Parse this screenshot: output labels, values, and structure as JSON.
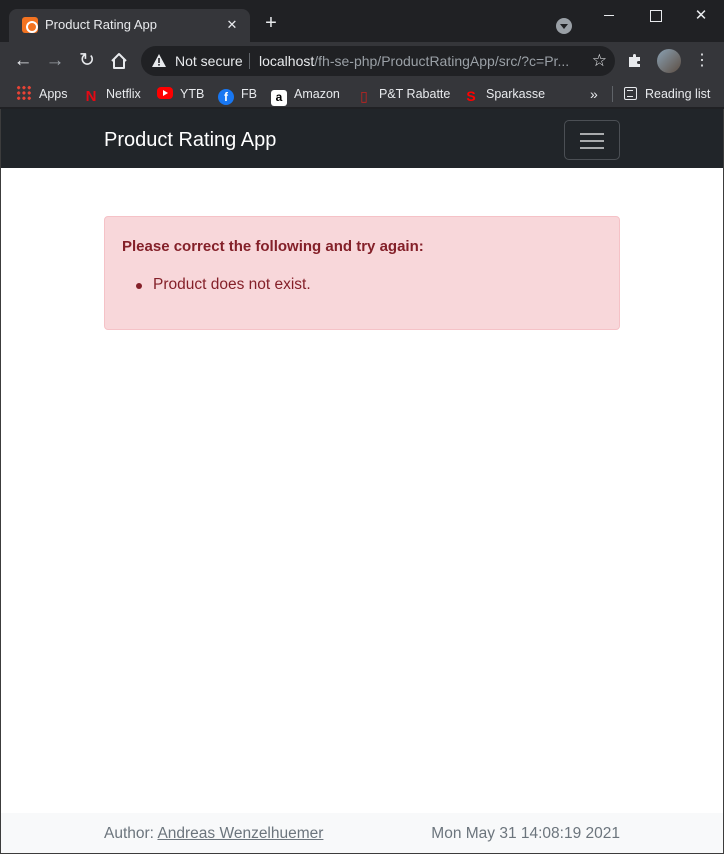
{
  "browser": {
    "tab_title": "Product Rating App",
    "tab_close_icon": "close-icon",
    "new_tab_icon": "plus-icon",
    "window_close_glyph": "✕",
    "security_label": "Not secure",
    "url_host": "localhost",
    "url_path": "/fh-se-php/ProductRatingApp/src/?c=Pr...",
    "bookmarks": [
      {
        "label": "Apps",
        "icon": "apps-grid-icon"
      },
      {
        "label": "Netflix",
        "icon": "netflix-icon"
      },
      {
        "label": "YTB",
        "icon": "youtube-icon"
      },
      {
        "label": "FB",
        "icon": "facebook-icon"
      },
      {
        "label": "Amazon",
        "icon": "amazon-icon"
      },
      {
        "label": "P&T Rabatte",
        "icon": "pt-rabatte-icon"
      },
      {
        "label": "Sparkasse",
        "icon": "sparkasse-icon"
      }
    ],
    "bookmarks_more": "»",
    "reading_list_label": "Reading list"
  },
  "app": {
    "brand": "Product Rating App",
    "alert": {
      "heading": "Please correct the following and try again:",
      "errors": [
        "Product does not exist."
      ]
    },
    "footer": {
      "author_prefix": "Author: ",
      "author_name": "Andreas Wenzelhuemer",
      "timestamp": "Mon May 31 14:08:19 2021"
    }
  },
  "colors": {
    "navbar": "#212529",
    "alert_bg": "#f8d7da",
    "alert_text": "#842029",
    "footer_bg": "#f8f9fa"
  }
}
